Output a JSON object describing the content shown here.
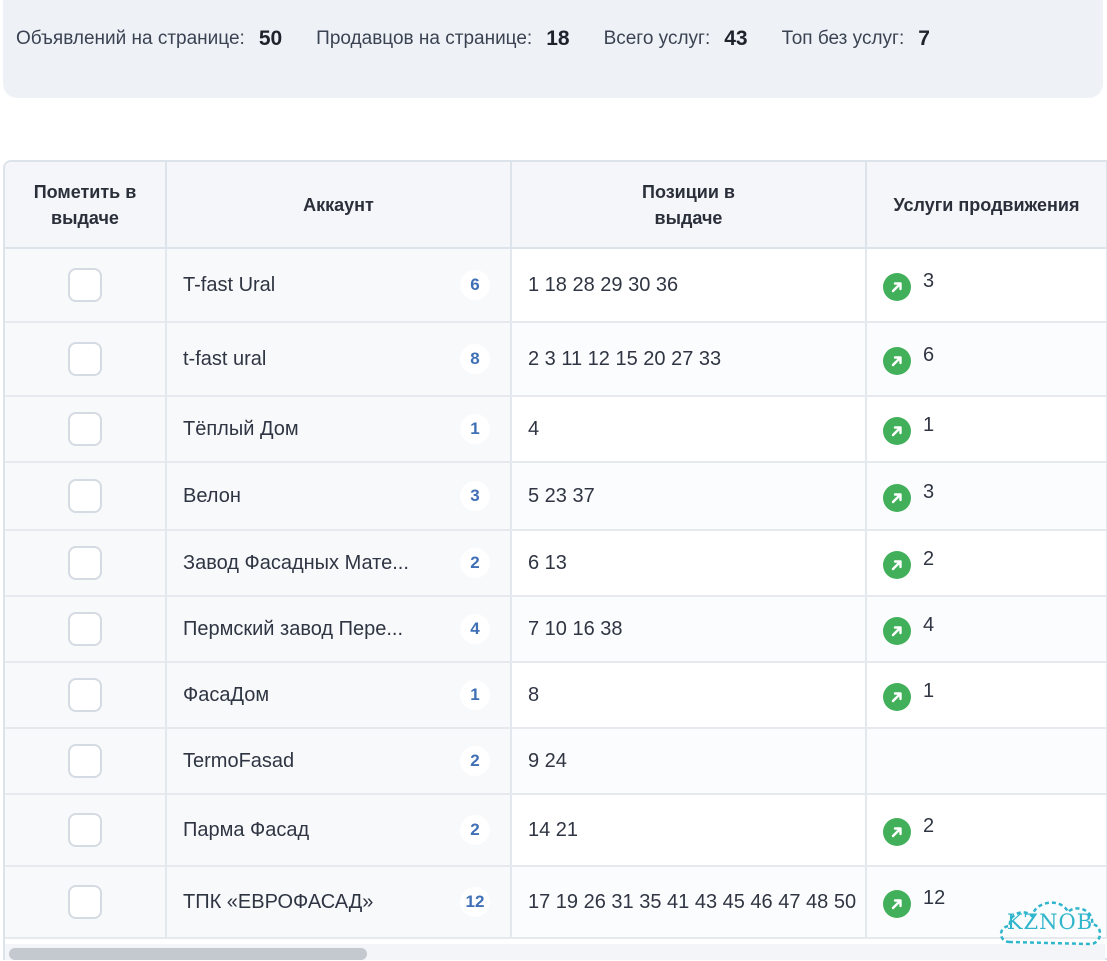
{
  "stats": {
    "ads_per_page_label": "Объявлений на странице:",
    "ads_per_page_value": "50",
    "sellers_per_page_label": "Продавцов на странице:",
    "sellers_per_page_value": "18",
    "total_services_label": "Всего услуг:",
    "total_services_value": "43",
    "top_without_services_label": "Топ без услуг:",
    "top_without_services_value": "7"
  },
  "table": {
    "headers": {
      "mark": "Пометить в выдаче",
      "account": "Аккаунт",
      "positions": "Позиции в выдаче",
      "services": "Услуги продвижения"
    },
    "rows": [
      {
        "account": "T-fast Ural",
        "count": "6",
        "positions": "1 18 28 29 30 36",
        "services": "3"
      },
      {
        "account": "t-fast ural",
        "count": "8",
        "positions": "2 3 11 12 15 20 27 33",
        "services": "6"
      },
      {
        "account": "Тёплый Дом",
        "count": "1",
        "positions": "4",
        "services": "1"
      },
      {
        "account": "Велон",
        "count": "3",
        "positions": "5 23 37",
        "services": "3"
      },
      {
        "account": "Завод Фасадных Мате...",
        "count": "2",
        "positions": "6 13",
        "services": "2"
      },
      {
        "account": "Пермский завод Пере...",
        "count": "4",
        "positions": "7 10 16 38",
        "services": "4"
      },
      {
        "account": "ФасаДом",
        "count": "1",
        "positions": "8",
        "services": "1"
      },
      {
        "account": "TermoFasad",
        "count": "2",
        "positions": "9 24",
        "services": null
      },
      {
        "account": "Парма Фасад",
        "count": "2",
        "positions": "14 21",
        "services": "2"
      },
      {
        "account": "ТПК «ЕВРОФАСАД»",
        "count": "12",
        "positions": "17 19 26 31 35 41 43 45 46 47 48 50",
        "services": "12"
      }
    ]
  },
  "icons": {
    "promotion": "arrow-up-right-icon",
    "promotion_color": "#42b05a",
    "count_color": "#3f6fb5"
  },
  "watermark": {
    "text": "KZNOB"
  }
}
